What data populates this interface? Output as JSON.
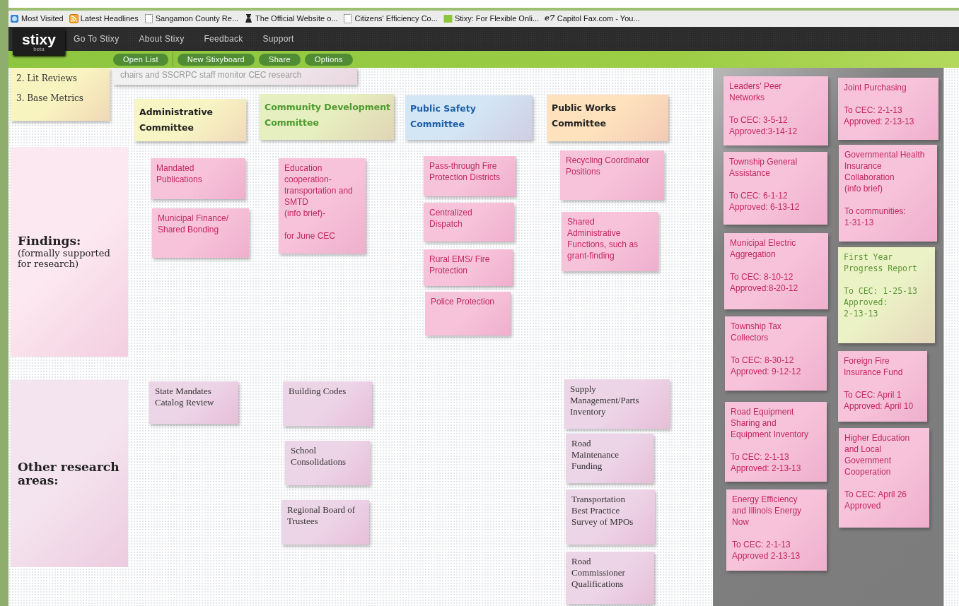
{
  "bookmarks": [
    {
      "label": "Most Visited",
      "kind": "globe"
    },
    {
      "label": "Latest Headlines",
      "kind": "feed"
    },
    {
      "label": "Sangamon County Re...",
      "kind": "page"
    },
    {
      "label": "The Official Website o...",
      "kind": "person"
    },
    {
      "label": "Citizens' Efficiency Co...",
      "kind": "page"
    },
    {
      "label": "Stixy: For Flexible Onli...",
      "kind": "square"
    },
    {
      "label": "Capitol Fax.com - You...",
      "kind": "text",
      "icon_text": "e7"
    }
  ],
  "logo": {
    "name": "stixy",
    "tag": "beta"
  },
  "nav": [
    "Go To Stixy",
    "About Stixy",
    "Feedback",
    "Support"
  ],
  "toolbar": [
    "Open List",
    "New Stixyboard",
    "Share",
    "Options"
  ],
  "notes": [
    {
      "kind": "list",
      "color": "#f8f4c0",
      "text": "2. Lit Reviews\n\n3. Base Metrics"
    },
    {
      "kind": "plain",
      "color": "#f1f1f1",
      "text": "chairs and SSCRPC staff monitor CEC research"
    },
    {
      "kind": "committee",
      "color": "#f8f5c4",
      "text": "Administrative\nCommittee"
    },
    {
      "kind": "committee",
      "color": "#e6efbf",
      "text": "Community Development\nCommittee"
    },
    {
      "kind": "committee",
      "color": "#d3e6f6",
      "text": "Public Safety\nCommittee"
    },
    {
      "kind": "committee",
      "color": "#fde2bd",
      "text": "Public Works\nCommittee"
    },
    {
      "kind": "section",
      "color": "#fce8f0",
      "text": "**Findings:**\n(formally supported\n for research)"
    },
    {
      "kind": "finding",
      "color": "#f7c3da",
      "text": "Mandated\nPublications"
    },
    {
      "kind": "finding",
      "color": "#f7c3da",
      "text": "Municipal Finance/\nShared Bonding"
    },
    {
      "kind": "finding",
      "color": "#f7c3da",
      "text": "Education\ncooperation-\ntransportation and\nSMTD\n(info brief)-\n\nfor June CEC"
    },
    {
      "kind": "finding",
      "color": "#f7c3da",
      "text": "Pass-through Fire\nProtection Districts"
    },
    {
      "kind": "finding",
      "color": "#f7c3da",
      "text": "Centralized\nDispatch"
    },
    {
      "kind": "finding",
      "color": "#f7c3da",
      "text": "Rural EMS/ Fire\nProtection"
    },
    {
      "kind": "finding",
      "color": "#f7c3da",
      "text": "Police Protection"
    },
    {
      "kind": "finding",
      "color": "#f7c3da",
      "text": "Recycling Coordinator\nPositions"
    },
    {
      "kind": "finding",
      "color": "#f7c3da",
      "text": "Shared\nAdministrative\nFunctions, such as\ngrant-finding"
    },
    {
      "kind": "section",
      "color": "#f4e4ef",
      "text": "**Other research\nareas:**"
    },
    {
      "kind": "research",
      "color": "#edd5e8",
      "text": "State Mandates\nCatalog Review"
    },
    {
      "kind": "research",
      "color": "#edd5e8",
      "text": "Building Codes"
    },
    {
      "kind": "research",
      "color": "#edd5e8",
      "text": "School\nConsolidations"
    },
    {
      "kind": "research",
      "color": "#edd5e8",
      "text": "Regional Board of\nTrustees"
    },
    {
      "kind": "research",
      "color": "#edd5e8",
      "text": "Supply\nManagement/Parts\nInventory"
    },
    {
      "kind": "research",
      "color": "#edd5e8",
      "text": "Road\nMaintenance\nFunding"
    },
    {
      "kind": "research",
      "color": "#edd5e8",
      "text": "Transportation\nBest Practice\nSurvey of MPOs"
    },
    {
      "kind": "research",
      "color": "#edd5e8",
      "text": "Road\nCommissioner\nQualifications"
    },
    {
      "kind": "finding",
      "color": "#f7c3da",
      "text": "Leaders' Peer\nNetworks\n\nTo CEC: 3-5-12\nApproved:3-14-12"
    },
    {
      "kind": "finding",
      "color": "#f7c3da",
      "text": "Township General\nAssistance\n\nTo CEC: 6-1-12\nApproved: 6-13-12"
    },
    {
      "kind": "finding",
      "color": "#f7c3da",
      "text": "Municipal Electric\nAggregation\n\nTo CEC: 8-10-12\nApproved:8-20-12"
    },
    {
      "kind": "finding",
      "color": "#f7c3da",
      "text": "Township Tax\nCollectors\n\nTo CEC: 8-30-12\nApproved: 9-12-12"
    },
    {
      "kind": "finding",
      "color": "#f7c3da",
      "text": "Road Equipment\nSharing and\nEquipment Inventory\n\nTo CEC: 2-1-13\nApproved: 2-13-13"
    },
    {
      "kind": "finding",
      "color": "#f7c3da",
      "text": "Energy Efficiency\nand Illinois Energy\nNow\n\nTo CEC: 2-1-13\nApproved 2-13-13"
    },
    {
      "kind": "finding",
      "color": "#f7c3da",
      "text": "Joint Purchasing\n\nTo CEC: 2-1-13\nApproved: 2-13-13"
    },
    {
      "kind": "finding",
      "color": "#f7c3da",
      "text": "Governmental Health\nInsurance\nCollaboration\n(info brief)\n\nTo communities:\n1-31-13"
    },
    {
      "kind": "report",
      "color": "#ebf2c6",
      "text": "First Year\nProgress Report\n\nTo CEC: 1-25-13\nApproved:\n2-13-13"
    },
    {
      "kind": "finding",
      "color": "#f7c3da",
      "text": "Foreign Fire\nInsurance Fund\n\nTo CEC: April 1\nApproved: April 10"
    },
    {
      "kind": "finding",
      "color": "#f7c3da",
      "text": "Higher Education\nand Local\nGovernment\nCooperation\n\nTo CEC: April 26\nApproved"
    }
  ]
}
